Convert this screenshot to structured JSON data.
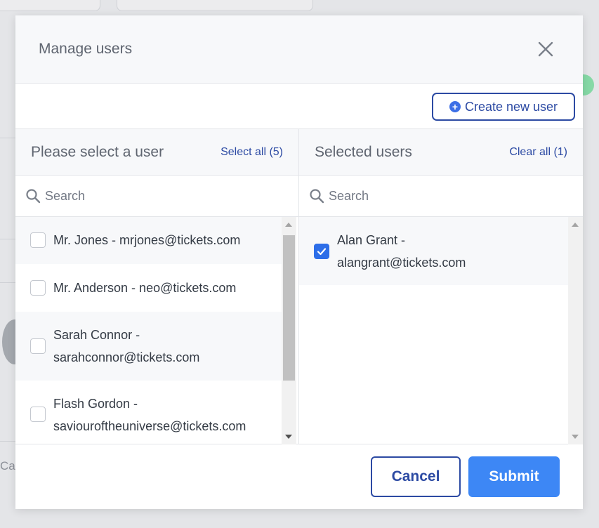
{
  "modal": {
    "title": "Manage users",
    "create_button_label": "Create new user",
    "cancel_label": "Cancel",
    "submit_label": "Submit"
  },
  "left_panel": {
    "title": "Please select a user",
    "action_label": "Select all (5)",
    "search_placeholder": "Search",
    "items": [
      {
        "line1": "Mr. Jones - mrjones@tickets.com",
        "line2": "",
        "checked": false
      },
      {
        "line1": "Mr. Anderson - neo@tickets.com",
        "line2": "",
        "checked": false
      },
      {
        "line1": "Sarah Connor -",
        "line2": "sarahconnor@tickets.com",
        "checked": false
      },
      {
        "line1": "Flash Gordon -",
        "line2": "saviouroftheuniverse@tickets.com",
        "checked": false
      }
    ]
  },
  "right_panel": {
    "title": "Selected users",
    "action_label": "Clear all (1)",
    "search_placeholder": "Search",
    "items": [
      {
        "line1": "Alan Grant -",
        "line2": "alangrant@tickets.com",
        "checked": true
      }
    ]
  },
  "icons": {
    "close": "close-icon",
    "search": "search-icon",
    "plus": "plus-circle-icon",
    "check": "checkmark-icon"
  },
  "colors": {
    "primary": "#2c4aa3",
    "accent": "#3d87f5",
    "checkbox_checked": "#2d6ee8"
  }
}
